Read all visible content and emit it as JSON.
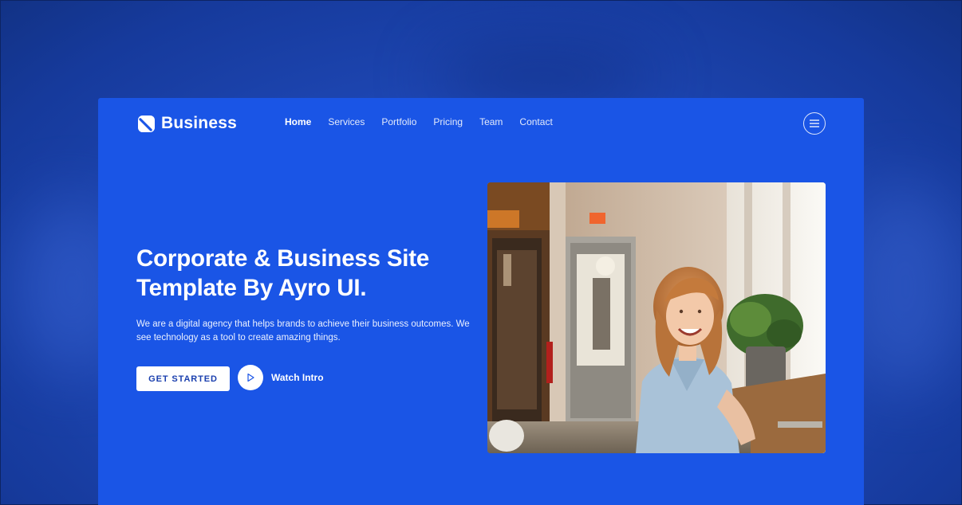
{
  "brand": {
    "name": "Business"
  },
  "nav": {
    "items": [
      {
        "label": "Home",
        "active": true
      },
      {
        "label": "Services",
        "active": false
      },
      {
        "label": "Portfolio",
        "active": false
      },
      {
        "label": "Pricing",
        "active": false
      },
      {
        "label": "Team",
        "active": false
      },
      {
        "label": "Contact",
        "active": false
      }
    ],
    "menu_icon": "hamburger-icon"
  },
  "hero": {
    "title_line1": "Corporate & Business Site",
    "title_line2": "Template By Ayro UI.",
    "description": "We are a digital agency that helps brands to achieve their business outcomes. We see technology as a tool to create amazing things.",
    "cta_label": "GET STARTED",
    "watch_label": "Watch Intro",
    "watch_icon": "play-icon"
  },
  "colors": {
    "page_bg": "#1e47b4",
    "site_bg": "#1a55e6",
    "button_text": "#1a3fae",
    "white": "#ffffff"
  }
}
